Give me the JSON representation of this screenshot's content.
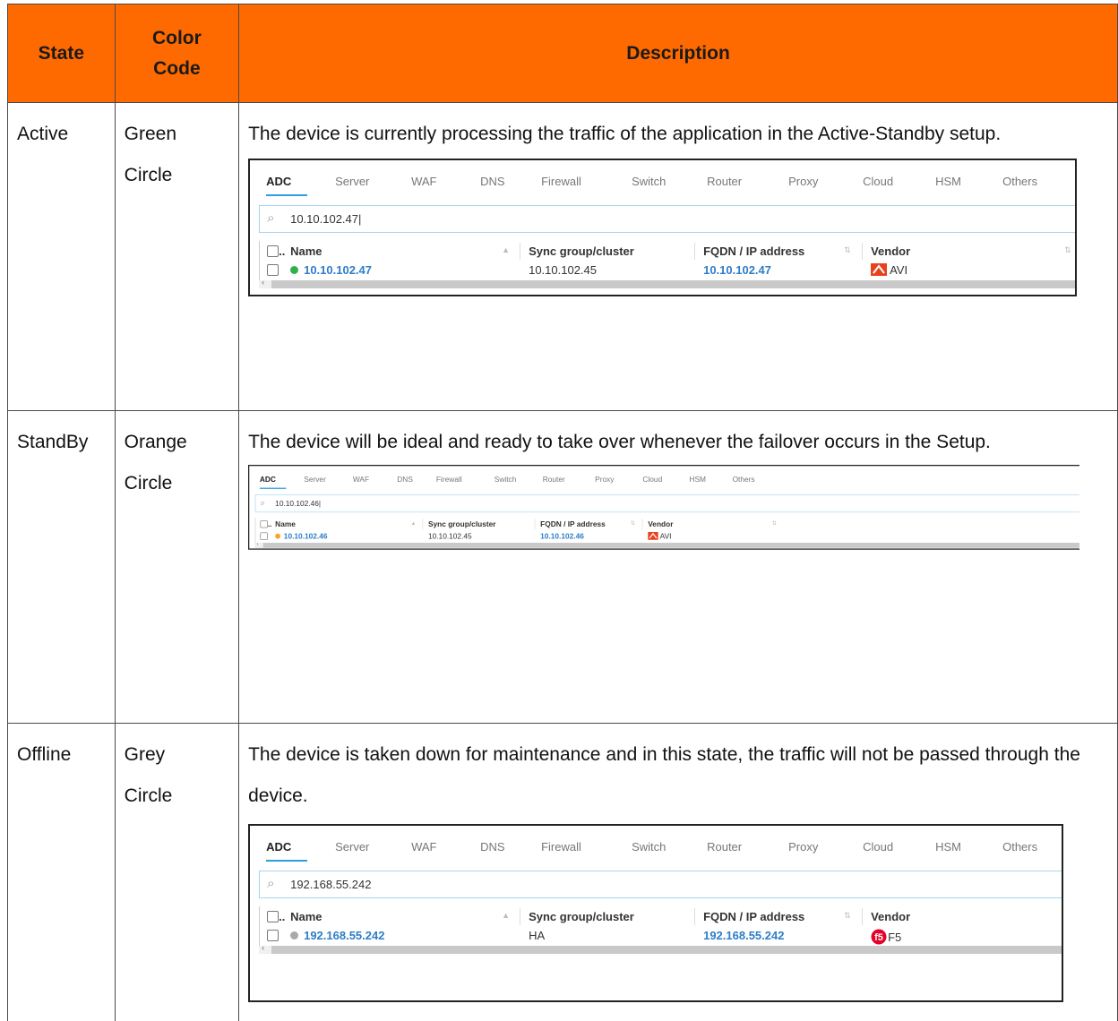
{
  "table": {
    "headers": {
      "state": "State",
      "color_code": "Color Code",
      "description": "Description"
    },
    "rows": [
      {
        "state": "Active",
        "color_code": "Green Circle",
        "description": "The device is currently processing the traffic of the application in the Active-Standby setup.",
        "screenshot": {
          "tabs": [
            "ADC",
            "Server",
            "WAF",
            "DNS",
            "Firewall",
            "Switch",
            "Router",
            "Proxy",
            "Cloud",
            "HSM",
            "Others"
          ],
          "search_value": "10.10.102.47|",
          "columns": [
            "Name",
            "Sync group/cluster",
            "FQDN / IP address",
            "Vendor"
          ],
          "row": {
            "name": "10.10.102.47",
            "sync_group": "10.10.102.45",
            "fqdn": "10.10.102.47",
            "vendor": "AVI"
          },
          "status_color": "#2db24a"
        }
      },
      {
        "state": "StandBy",
        "color_code": "Orange Circle",
        "description": "The device will be ideal and ready to take over whenever the failover occurs in the Setup.",
        "screenshot": {
          "tabs": [
            "ADC",
            "Server",
            "WAF",
            "DNS",
            "Firewall",
            "Switch",
            "Router",
            "Proxy",
            "Cloud",
            "HSM",
            "Others"
          ],
          "search_value": "10.10.102.46|",
          "columns": [
            "Name",
            "Sync group/cluster",
            "FQDN / IP address",
            "Vendor"
          ],
          "row": {
            "name": "10.10.102.46",
            "sync_group": "10.10.102.45",
            "fqdn": "10.10.102.46",
            "vendor": "AVI"
          },
          "status_color": "#f5a623"
        }
      },
      {
        "state": "Offline",
        "color_code": "Grey Circle",
        "description": "The device is taken down for maintenance and in this state, the traffic will not be passed through the device.",
        "screenshot": {
          "tabs": [
            "ADC",
            "Server",
            "WAF",
            "DNS",
            "Firewall",
            "Switch",
            "Router",
            "Proxy",
            "Cloud",
            "HSM",
            "Others"
          ],
          "search_value": "192.168.55.242",
          "columns": [
            "Name",
            "Sync group/cluster",
            "FQDN / IP address",
            "Vendor"
          ],
          "row": {
            "name": "192.168.55.242",
            "sync_group": "HA",
            "fqdn": "192.168.55.242",
            "vendor": "F5"
          },
          "status_color": "#a9a9a9"
        }
      }
    ]
  },
  "colors": {
    "header_background": "#ff6a00",
    "link": "#2e7dc8",
    "tab_underline": "#2f9de0",
    "avi_logo": "#e8411e",
    "f5_logo": "#e4002b"
  },
  "icons": {
    "search": "magnifier-icon",
    "checkbox": "checkbox-icon",
    "sort": "sort-arrow-icon",
    "avi_logo": "avi-logo-icon",
    "f5_logo": "f5-logo-icon"
  }
}
